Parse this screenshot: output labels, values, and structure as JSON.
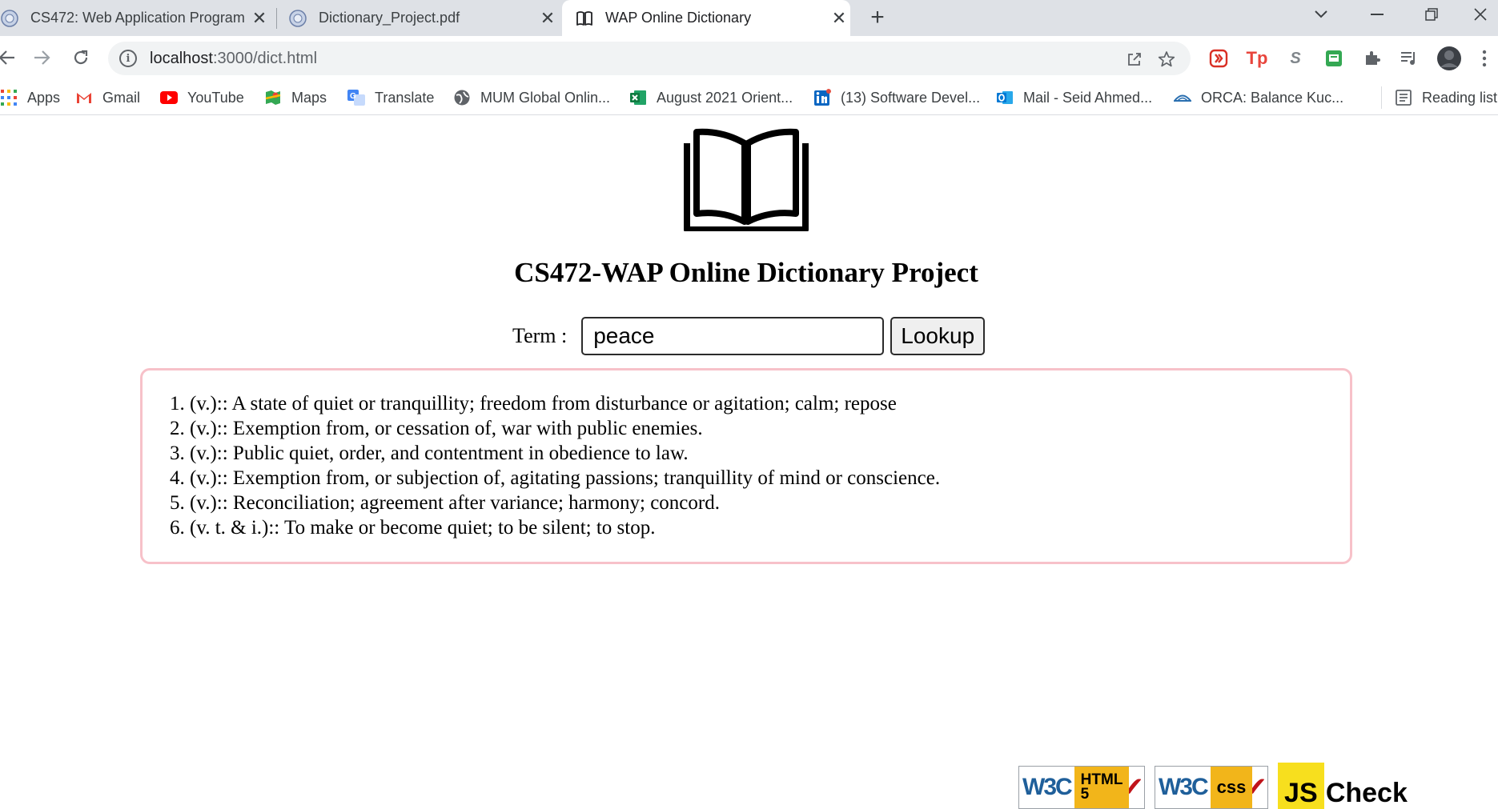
{
  "browser": {
    "tabs": [
      {
        "title": "CS472: Web Application Program",
        "active": false
      },
      {
        "title": "Dictionary_Project.pdf",
        "active": false
      },
      {
        "title": "WAP Online Dictionary",
        "active": true
      }
    ],
    "address": {
      "host": "localhost",
      "path": ":3000/dict.html"
    },
    "bookmarks": [
      {
        "label": "Apps"
      },
      {
        "label": "Gmail"
      },
      {
        "label": "YouTube"
      },
      {
        "label": "Maps"
      },
      {
        "label": "Translate"
      },
      {
        "label": "MUM Global Onlin..."
      },
      {
        "label": "August 2021 Orient..."
      },
      {
        "label": "(13) Software Devel..."
      },
      {
        "label": "Mail - Seid Ahmed..."
      },
      {
        "label": "ORCA: Balance Kuc..."
      },
      {
        "label": "Reading list"
      }
    ]
  },
  "page": {
    "title": "CS472-WAP Online Dictionary Project",
    "search": {
      "label": "Term :",
      "value": "peace",
      "button": "Lookup"
    },
    "definitions": [
      "1. (v.):: A state of quiet or tranquillity; freedom from disturbance or agitation; calm; repose",
      "2. (v.):: Exemption from, or cessation of, war with public enemies.",
      "3. (v.):: Public quiet, order, and contentment in obedience to law.",
      "4. (v.):: Exemption from, or subjection of, agitating passions; tranquillity of mind or conscience.",
      "5. (v.):: Reconciliation; agreement after variance; harmony; concord.",
      "6. (v. t. & i.):: To make or become quiet; to be silent; to stop."
    ],
    "badges": {
      "html": {
        "brand": "W3C",
        "tag_line1": "HTML",
        "tag_line2": "5"
      },
      "css": {
        "brand": "W3C",
        "tag": "css"
      },
      "js": {
        "js": "JS",
        "check": "Check"
      }
    }
  }
}
